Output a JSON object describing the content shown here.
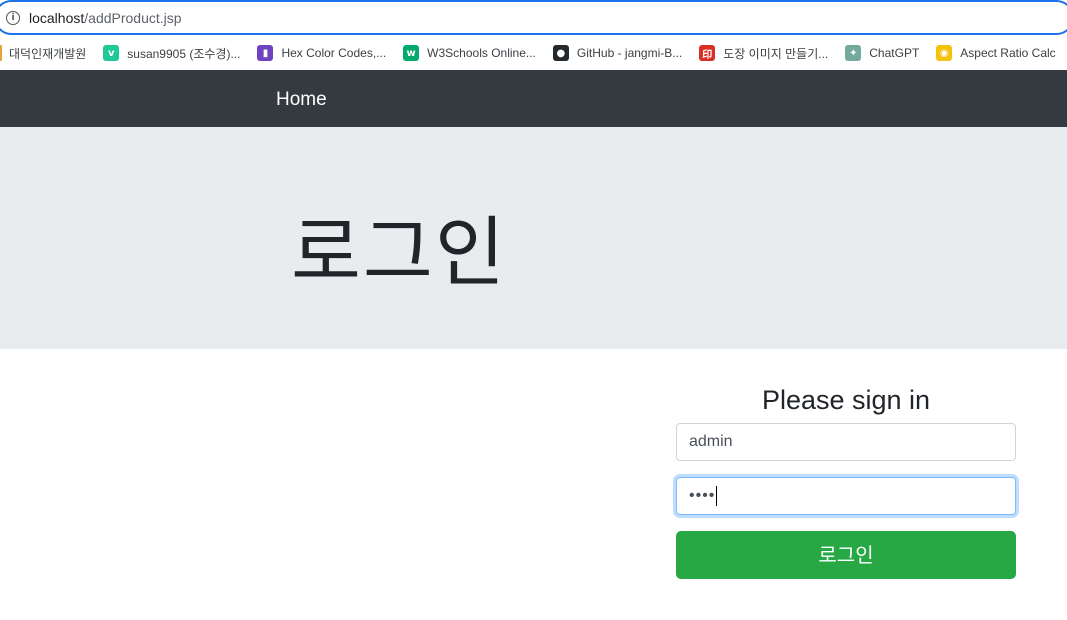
{
  "browser": {
    "url_host": "localhost",
    "url_path": "/addProduct.jsp"
  },
  "bookmarks": [
    {
      "label": "대덕인재개발원",
      "icon": "folder-icon",
      "color": "#e8a33d",
      "glyph": ""
    },
    {
      "label": "susan9905 (조수경)...",
      "icon": "velog-icon",
      "color": "#20c997",
      "glyph": "v"
    },
    {
      "label": "Hex Color Codes,...",
      "icon": "color-book-icon",
      "color": "#6f42c1",
      "glyph": "▮"
    },
    {
      "label": "W3Schools Online...",
      "icon": "w3schools-icon",
      "color": "#04aa6d",
      "glyph": "w"
    },
    {
      "label": "GitHub - jangmi-B...",
      "icon": "github-icon",
      "color": "#24292e",
      "glyph": "●"
    },
    {
      "label": "도장 이미지 만들기...",
      "icon": "stamp-icon",
      "color": "#d93025",
      "glyph": "印"
    },
    {
      "label": "ChatGPT",
      "icon": "chatgpt-icon",
      "color": "#74aa9c",
      "glyph": "✦"
    },
    {
      "label": "Aspect Ratio Calc",
      "icon": "aspect-ratio-icon",
      "color": "#f4c20d",
      "glyph": "◉"
    }
  ],
  "navbar": {
    "home_label": "Home"
  },
  "jumbotron": {
    "title": "로그인"
  },
  "login_form": {
    "heading": "Please sign in",
    "id_value": "admin",
    "password_mask": "••••",
    "submit_label": "로그인"
  },
  "colors": {
    "navbar": "#343a40",
    "jumbotron": "#e9ecef",
    "submit_button": "#28a745",
    "focus_ring": "#80bdff"
  }
}
